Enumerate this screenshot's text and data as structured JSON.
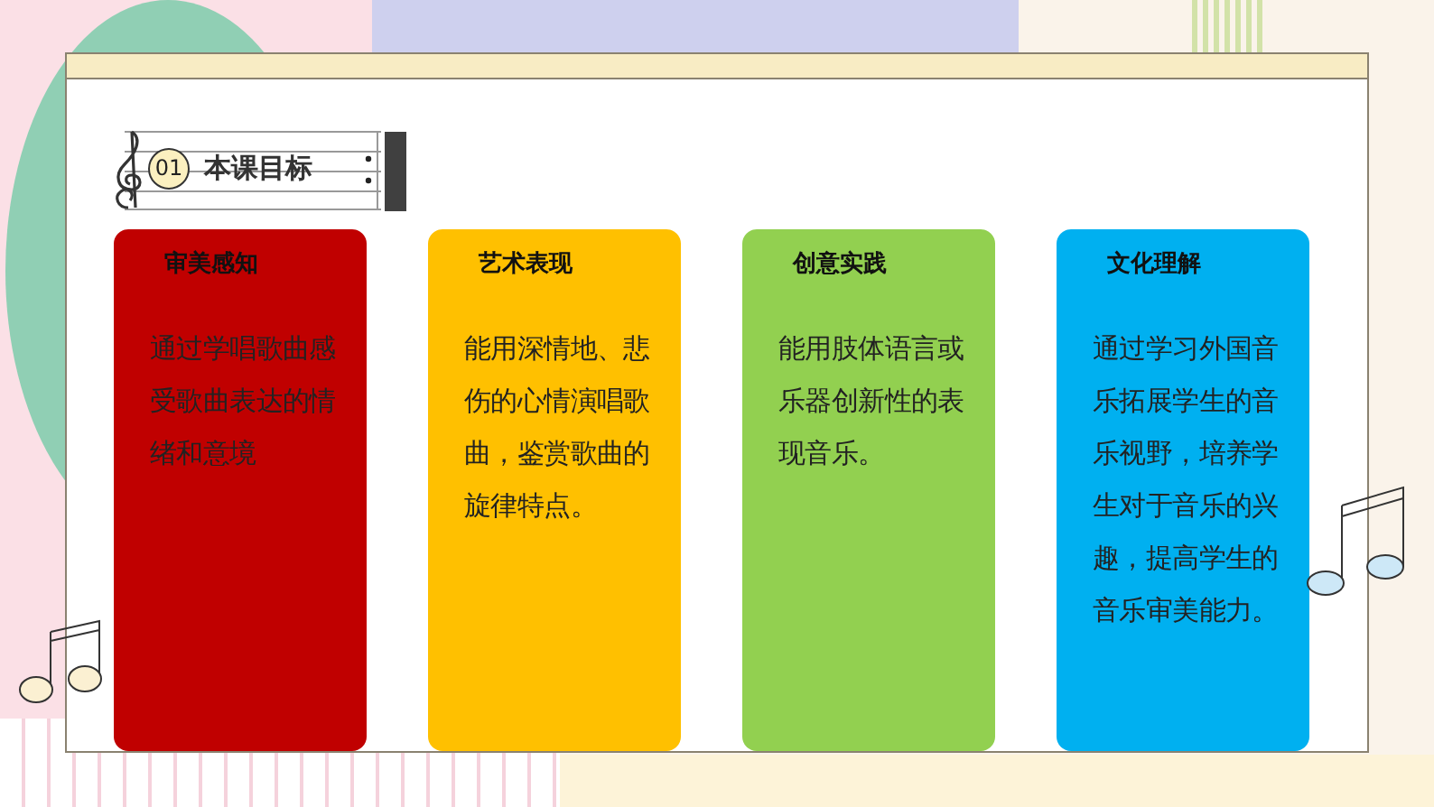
{
  "section": {
    "number": "01",
    "title": "本课目标"
  },
  "cards": [
    {
      "heading": "审美感知",
      "body": "通过学唱歌曲感受歌曲表达的情绪和意境",
      "color": "#c00000"
    },
    {
      "heading": "艺术表现",
      "body": "能用深情地、悲伤的心情演唱歌曲，鉴赏歌曲的旋律特点。",
      "color": "#ffc000"
    },
    {
      "heading": "创意实践",
      "body": "能用肢体语言或乐器创新性的表现音乐。",
      "color": "#92d050"
    },
    {
      "heading": "文化理解",
      "body": "通过学习外国音乐拓展学生的音乐视野，培养学生对于音乐的兴趣，提高学生的音乐审美能力。",
      "color": "#00b0f0"
    }
  ]
}
